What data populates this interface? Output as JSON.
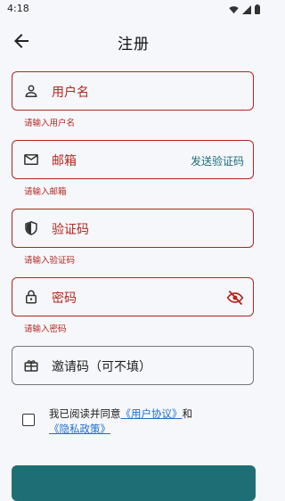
{
  "status_bar": {
    "time": "4:18",
    "icons": [
      "wifi-icon",
      "signal-icon",
      "battery-icon"
    ]
  },
  "app_bar": {
    "title": "注册",
    "back_icon": "arrow-left-icon"
  },
  "form": {
    "username": {
      "label": "用户名",
      "icon": "person-icon",
      "error": "请输入用户名"
    },
    "email": {
      "label": "邮箱",
      "icon": "mail-icon",
      "action": "发送验证码",
      "error": "请输入邮箱"
    },
    "code": {
      "label": "验证码",
      "icon": "shield-icon",
      "error": "请输入验证码"
    },
    "password": {
      "label": "密码",
      "icon": "lock-icon",
      "trail_icon": "eye-off-icon",
      "error": "请输入密码"
    },
    "invite": {
      "label": "邀请码（可不填）",
      "icon": "gift-icon"
    }
  },
  "agreement": {
    "prefix": "我已阅读并同意",
    "user_agreement": "《用户协议》",
    "conjunction": "和",
    "privacy_policy": "《隐私政策》"
  },
  "colors": {
    "error": "#b3261e",
    "link": "#1e6fd0",
    "accent": "#1d6f75",
    "background": "#f5f7fa"
  }
}
